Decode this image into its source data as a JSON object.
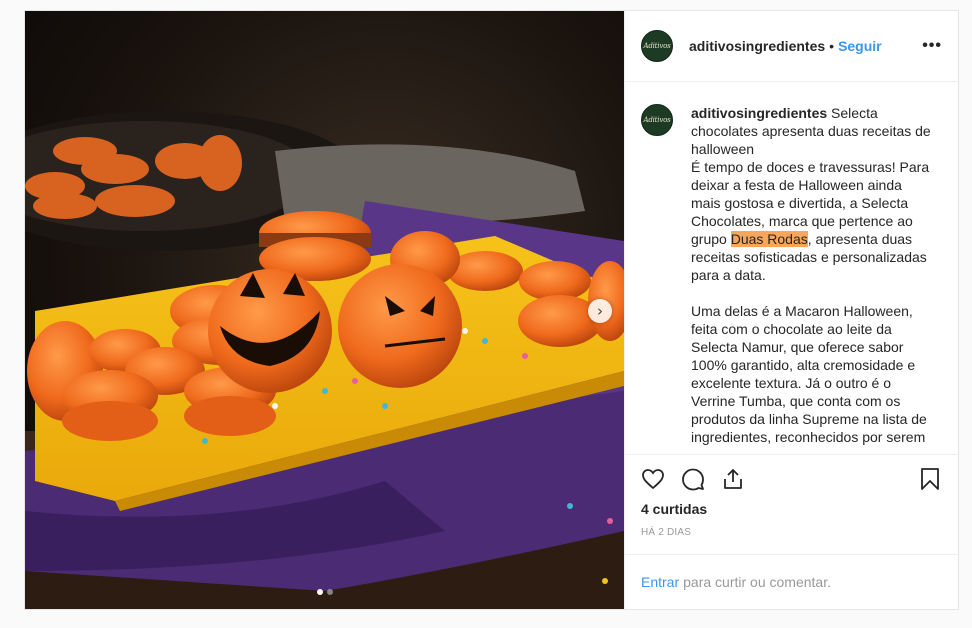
{
  "post": {
    "username": "aditivosingredientes",
    "separator": "•",
    "follow_label": "Seguir",
    "avatar_text": "Aditivos",
    "more_label": "•••",
    "next_arrow": "›",
    "carousel": {
      "count": 2,
      "active": 1
    }
  },
  "caption": {
    "username": "aditivosingredientes",
    "line1_text": "Selecta chocolates apresenta duas receitas de halloween",
    "p1_before": "É tempo de doces e travessuras! Para deixar a festa de Halloween ainda mais gostosa e divertida, a Selecta Chocolates, marca que pertence ao grupo ",
    "p1_highlight": "Duas Rodas",
    "p1_after": ", apresenta duas receitas sofisticadas e personalizadas para a data.",
    "p2": "Uma delas é a Macaron Halloween, feita com o chocolate ao leite da Selecta Namur, que oferece sabor 100% garantido, alta cremosidade e excelente textura. Já o outro é o Verrine Tumba, que conta com os produtos da linha Supreme na lista de ingredientes, reconhecidos por serem"
  },
  "actions": {
    "icons": [
      "heart-icon",
      "comment-icon",
      "share-icon",
      "bookmark-icon"
    ],
    "likes": "4 curtidas",
    "date": "HÁ 2 DIAS"
  },
  "comment": {
    "login_link": "Entrar",
    "rest": "para curtir ou comentar."
  },
  "colors": {
    "link": "#3897f0",
    "highlight": "#f9a55a",
    "avatar_bg": "#1d3b24"
  }
}
